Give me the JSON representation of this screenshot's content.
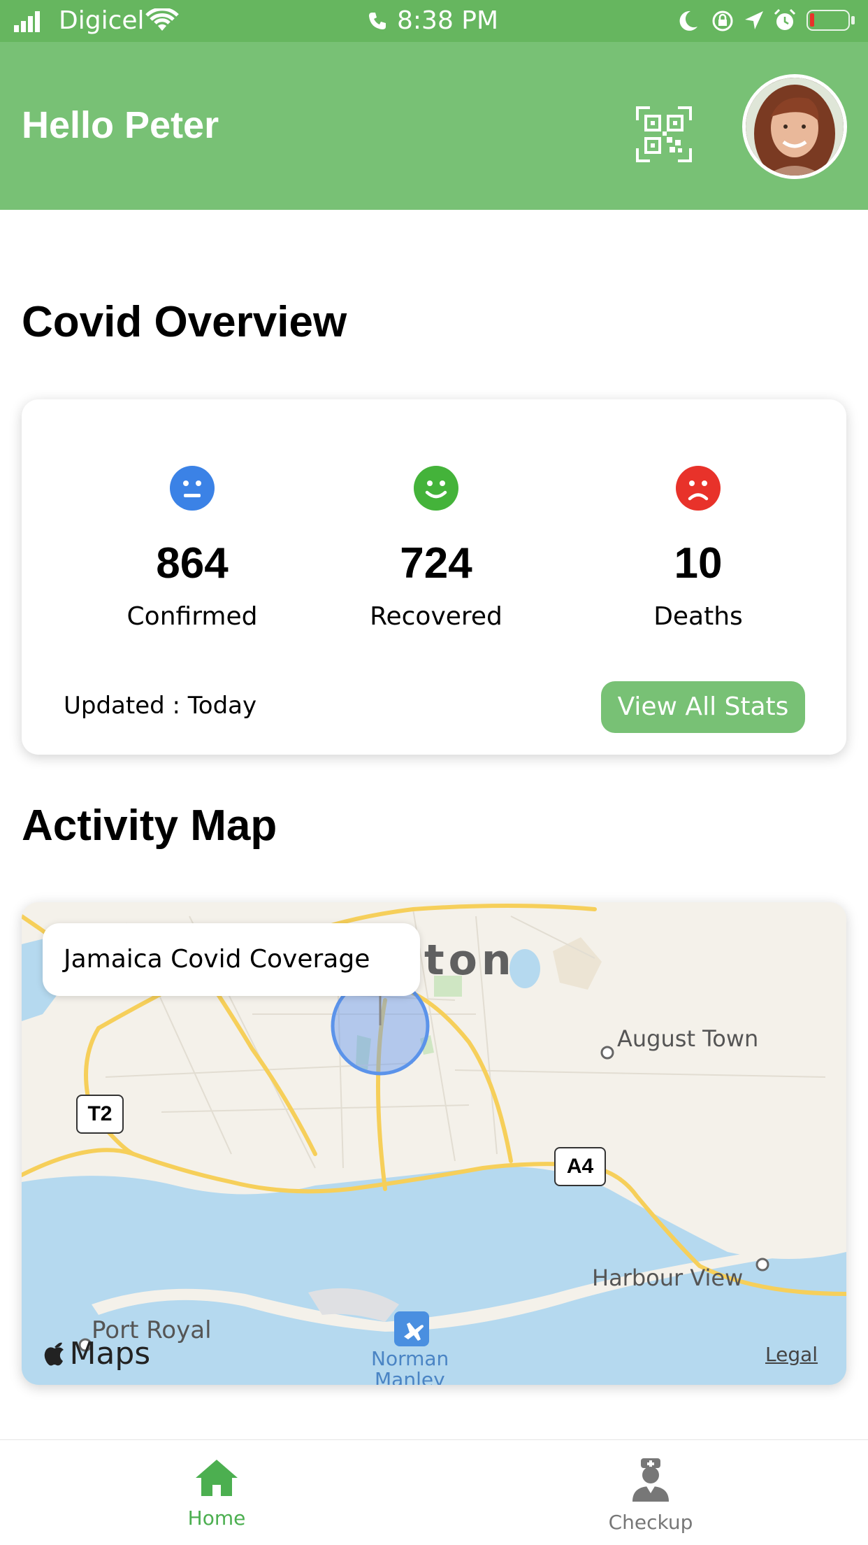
{
  "status_bar": {
    "carrier": "Digicel",
    "time": "8:38 PM"
  },
  "header": {
    "greeting": "Hello Peter"
  },
  "overview": {
    "title": "Covid Overview",
    "stats": [
      {
        "value": "864",
        "label": "Confirmed",
        "color": "#3b82e6"
      },
      {
        "value": "724",
        "label": "Recovered",
        "color": "#44b33a"
      },
      {
        "value": "10",
        "label": "Deaths",
        "color": "#e8322a"
      }
    ],
    "updated": "Updated : Today",
    "view_all_label": "View All Stats"
  },
  "activity_map": {
    "title": "Activity Map",
    "tooltip": "Jamaica Covid Coverage",
    "labels": {
      "city_fragment": "ton",
      "august_town": "August Town",
      "harbour_view": "Harbour View",
      "port_royal": "Port Royal",
      "norman": "Norman",
      "manley": "Manley",
      "t2": "T2",
      "a4": "A4",
      "maps_brand": "Maps",
      "legal": "Legal"
    }
  },
  "bottom_nav": {
    "items": [
      {
        "label": "Home",
        "icon": "home-icon",
        "active": true,
        "color": "#4caf50"
      },
      {
        "label": "Checkup",
        "icon": "doctor-icon",
        "active": false,
        "color": "#777777"
      }
    ]
  }
}
